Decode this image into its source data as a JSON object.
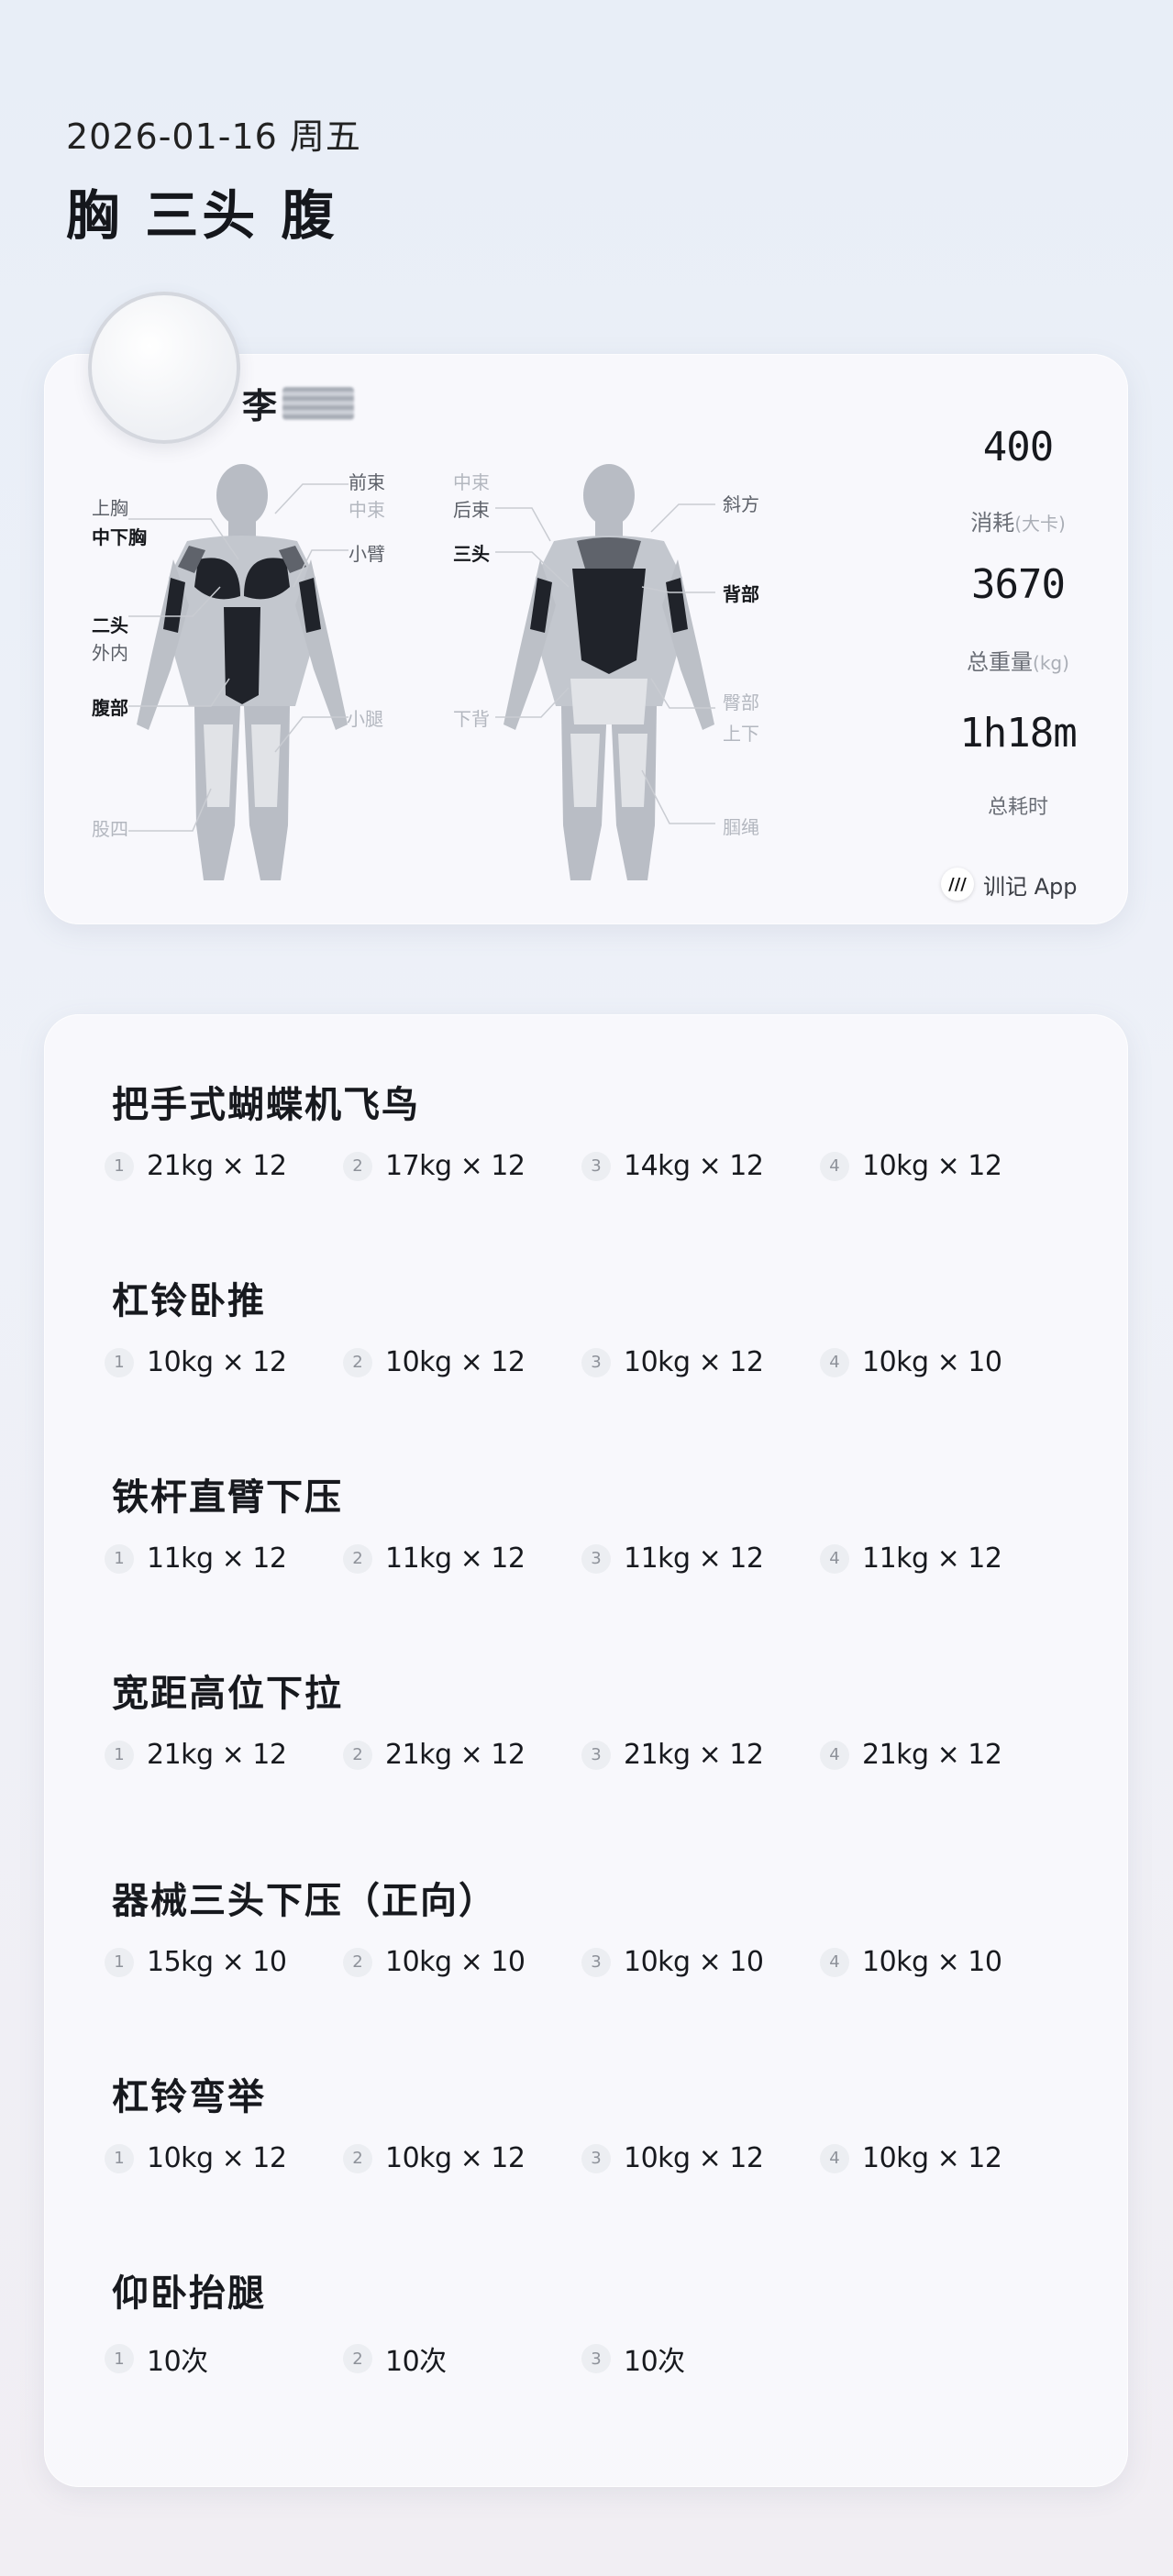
{
  "header": {
    "date": "2026-01-16 周五",
    "focus": "胸 三头 腹"
  },
  "profile": {
    "name_visible": "李"
  },
  "muscles": {
    "front_left": [
      {
        "label": "上胸",
        "state": "mid"
      },
      {
        "label": "中下胸",
        "state": "dark"
      },
      {
        "label": "二头",
        "state": "dark"
      },
      {
        "label": "外内",
        "state": "mid"
      },
      {
        "label": "腹部",
        "state": "dark"
      },
      {
        "label": "股四",
        "state": "light"
      }
    ],
    "front_right": [
      {
        "label": "前束",
        "state": "mid"
      },
      {
        "label": "中束",
        "state": "light"
      },
      {
        "label": "小臂",
        "state": "mid"
      },
      {
        "label": "小腿",
        "state": "light"
      }
    ],
    "back_left": [
      {
        "label": "中束",
        "state": "light"
      },
      {
        "label": "后束",
        "state": "mid"
      },
      {
        "label": "三头",
        "state": "dark"
      },
      {
        "label": "下背",
        "state": "light"
      }
    ],
    "back_right": [
      {
        "label": "斜方",
        "state": "mid"
      },
      {
        "label": "背部",
        "state": "dark"
      },
      {
        "label": "臀部",
        "state": "light"
      },
      {
        "label": "上下",
        "state": "light"
      },
      {
        "label": "腘绳",
        "state": "light"
      }
    ]
  },
  "stats": {
    "calories_value": "400",
    "calories_label": "消耗",
    "calories_unit": "(大卡)",
    "volume_value": "3670",
    "volume_label": "总重量",
    "volume_unit": "(kg)",
    "duration_value": "1h18m",
    "duration_label": "总耗时"
  },
  "brand": {
    "logo_text": "///",
    "name": "训记 App"
  },
  "exercises": [
    {
      "name": "把手式蝴蝶机飞鸟",
      "sets": [
        {
          "n": "1",
          "v": "21kg × 12"
        },
        {
          "n": "2",
          "v": "17kg × 12"
        },
        {
          "n": "3",
          "v": "14kg × 12"
        },
        {
          "n": "4",
          "v": "10kg × 12"
        }
      ]
    },
    {
      "name": "杠铃卧推",
      "sets": [
        {
          "n": "1",
          "v": "10kg × 12"
        },
        {
          "n": "2",
          "v": "10kg × 12"
        },
        {
          "n": "3",
          "v": "10kg × 12"
        },
        {
          "n": "4",
          "v": "10kg × 10"
        }
      ]
    },
    {
      "name": "铁杆直臂下压",
      "sets": [
        {
          "n": "1",
          "v": "11kg × 12"
        },
        {
          "n": "2",
          "v": "11kg × 12"
        },
        {
          "n": "3",
          "v": "11kg × 12"
        },
        {
          "n": "4",
          "v": "11kg × 12"
        }
      ]
    },
    {
      "name": "宽距高位下拉",
      "sets": [
        {
          "n": "1",
          "v": "21kg × 12"
        },
        {
          "n": "2",
          "v": "21kg × 12"
        },
        {
          "n": "3",
          "v": "21kg × 12"
        },
        {
          "n": "4",
          "v": "21kg × 12"
        }
      ]
    },
    {
      "name": "器械三头下压（正向）",
      "sets": [
        {
          "n": "1",
          "v": "15kg × 10"
        },
        {
          "n": "2",
          "v": "10kg × 10"
        },
        {
          "n": "3",
          "v": "10kg × 10"
        },
        {
          "n": "4",
          "v": "10kg × 10"
        }
      ]
    },
    {
      "name": "杠铃弯举",
      "sets": [
        {
          "n": "1",
          "v": "10kg × 12"
        },
        {
          "n": "2",
          "v": "10kg × 12"
        },
        {
          "n": "3",
          "v": "10kg × 12"
        },
        {
          "n": "4",
          "v": "10kg × 12"
        }
      ]
    },
    {
      "name": "仰卧抬腿",
      "sets": [
        {
          "n": "1",
          "v": "10次"
        },
        {
          "n": "2",
          "v": "10次"
        },
        {
          "n": "3",
          "v": "10次"
        }
      ]
    }
  ]
}
